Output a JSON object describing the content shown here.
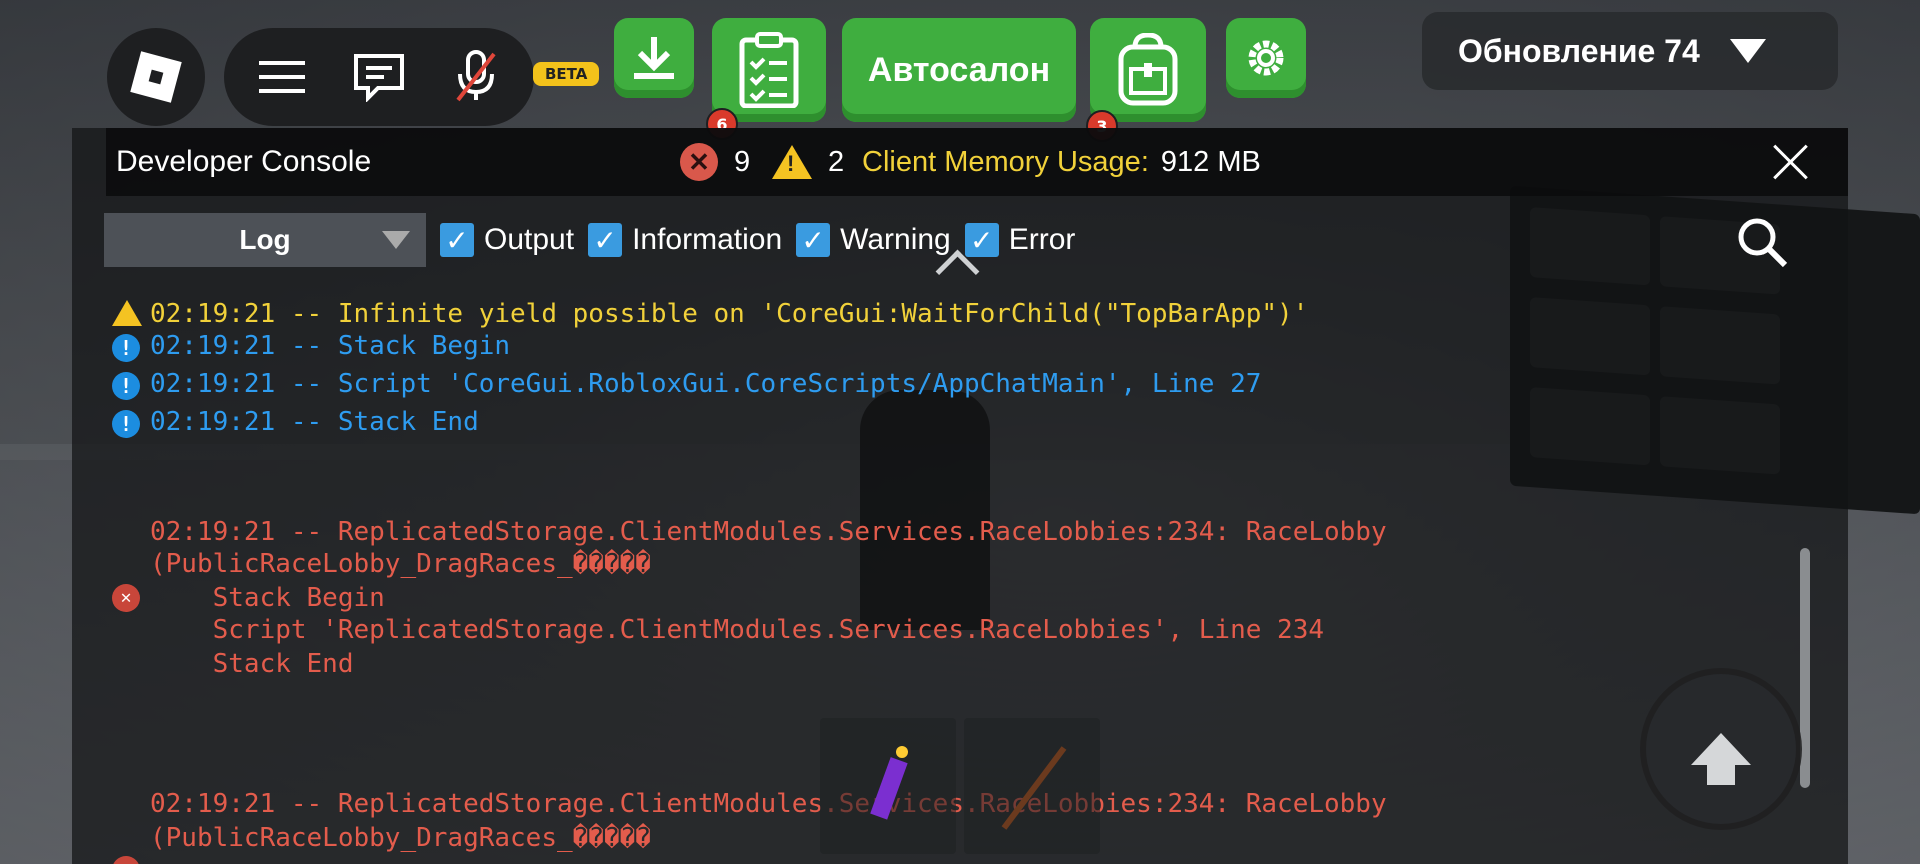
{
  "topbar": {
    "roblox_icon": "roblox-logo-icon",
    "beta_label": "BETA",
    "autosalon_label": "Автосалон",
    "quests_badge": "6",
    "backpack_badge": "3",
    "update_title": "Обновление 74"
  },
  "console": {
    "title": "Developer Console",
    "error_count": "9",
    "warning_count": "2",
    "memory_label": "Client Memory Usage:",
    "memory_value": "912 MB",
    "log_select": "Log",
    "filters": [
      "Output",
      "Information",
      "Warning",
      "Error"
    ],
    "lines": {
      "warn1": "02:19:21 -- Infinite yield possible on 'CoreGui:WaitForChild(\"TopBarApp\")'",
      "info1": "02:19:21 -- Stack Begin",
      "info2": "02:19:21 -- Script 'CoreGui.RobloxGui.CoreScripts/AppChatMain', Line 27",
      "info3": "02:19:21 -- Stack End",
      "err1a": "02:19:21 -- ReplicatedStorage.ClientModules.Services.RaceLobbies:234: RaceLobby",
      "err1b": "(PublicRaceLobby_DragRaces_�����",
      "err1c": "    Stack Begin",
      "err1d": "    Script 'ReplicatedStorage.ClientModules.Services.RaceLobbies', Line 234",
      "err1e": "    Stack End",
      "err2a": "02:19:21 -- ReplicatedStorage.ClientModules.Services.RaceLobbies:234: RaceLobby",
      "err2b": "(PublicRaceLobby_DragRaces_�����"
    }
  },
  "colors": {
    "green": "#3fae3f",
    "info": "#2e9cf0",
    "warning": "#f1d13a",
    "error": "#e35c4c"
  }
}
